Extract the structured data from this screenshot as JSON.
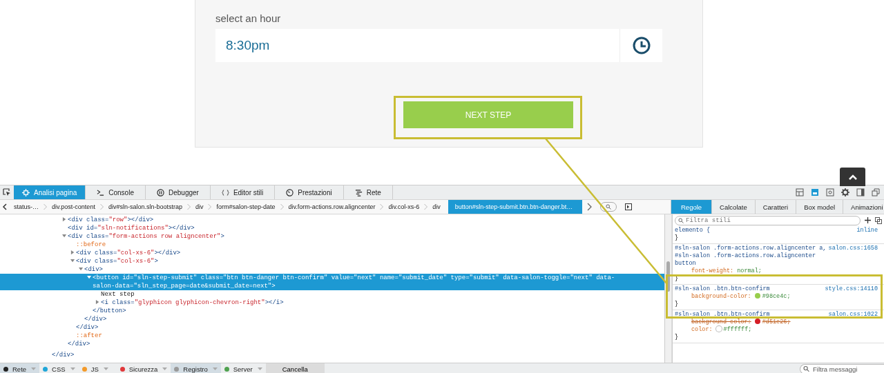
{
  "page": {
    "hour_label": "select an hour",
    "hour_value": "8:30pm",
    "next_button": "NEXT STEP"
  },
  "toolbar": {
    "tabs": [
      {
        "label": "Analisi pagina",
        "selected": true
      },
      {
        "label": "Console",
        "selected": false
      },
      {
        "label": "Debugger",
        "selected": false
      },
      {
        "label": "Editor stili",
        "selected": false
      },
      {
        "label": "Prestazioni",
        "selected": false
      },
      {
        "label": "Rete",
        "selected": false
      }
    ]
  },
  "breadcrumbs": [
    {
      "label": "status-…",
      "selected": false
    },
    {
      "label": "div.post-content",
      "selected": false
    },
    {
      "label": "div#sln-salon.sln-bootstrap",
      "selected": false
    },
    {
      "label": "div",
      "selected": false
    },
    {
      "label": "form#salon-step-date",
      "selected": false
    },
    {
      "label": "div.form-actions.row.aligncenter",
      "selected": false
    },
    {
      "label": "div.col-xs-6",
      "selected": false
    },
    {
      "label": "div",
      "selected": false
    },
    {
      "label": "button#sln-step-submit.btn.btn-danger.bt…",
      "selected": true
    }
  ],
  "markup": {
    "nodes": [
      {
        "kind": "element",
        "open": "<div",
        "attrs": [
          {
            "name": " class=",
            "value": "\"row\""
          }
        ],
        "end": ">",
        "inline_close": "</div>",
        "expanded": false,
        "selected": false
      },
      {
        "kind": "element",
        "open": "<div",
        "attrs": [
          {
            "name": " id=",
            "value": "\"sln-notifications\""
          }
        ],
        "end": ">",
        "inline_close": "</div>",
        "selected": false
      },
      {
        "kind": "element",
        "open": "<div",
        "attrs": [
          {
            "name": " class=",
            "value": "\"form-actions row aligncenter\""
          }
        ],
        "end": ">",
        "expanded": true,
        "selected": false,
        "close": "</div>",
        "children": [
          {
            "kind": "pseudo",
            "text": "::before"
          },
          {
            "kind": "element",
            "open": "<div",
            "attrs": [
              {
                "name": " class=",
                "value": "\"col-xs-6\""
              }
            ],
            "end": ">",
            "inline_close": "</div>",
            "expanded": false,
            "selected": false
          },
          {
            "kind": "element",
            "open": "<div",
            "attrs": [
              {
                "name": " class=",
                "value": "\"col-xs-6\""
              }
            ],
            "end": ">",
            "expanded": true,
            "selected": false,
            "close": "</div>",
            "children": [
              {
                "kind": "element",
                "open": "<div",
                "end": ">",
                "expanded": true,
                "selected": false,
                "close": "</div>",
                "children": [
                  {
                    "kind": "element",
                    "open": "<button",
                    "attrs": [
                      {
                        "name": " id=",
                        "value": "\"sln-step-submit\""
                      },
                      {
                        "name": " class=",
                        "value": "\"btn btn-danger btn-confirm\""
                      },
                      {
                        "name": " value=",
                        "value": "\"next\""
                      },
                      {
                        "name": " name=",
                        "value": "\"submit_date\""
                      },
                      {
                        "name": " type=",
                        "value": "\"submit\""
                      },
                      {
                        "name": " data-salon-toggle=",
                        "value": "\"next\""
                      },
                      {
                        "name": " data-salon-data=",
                        "value": "\"sln_step_page=date&submit_date=next\""
                      }
                    ],
                    "end": ">",
                    "expanded": true,
                    "selected": true,
                    "close": "</button>",
                    "children": [
                      {
                        "kind": "text",
                        "text": "Next step"
                      },
                      {
                        "kind": "element",
                        "open": "<i",
                        "attrs": [
                          {
                            "name": " class=",
                            "value": "\"glyphicon glyphicon-chevron-right\""
                          }
                        ],
                        "end": ">",
                        "inline_close": "</i>",
                        "expanded": false,
                        "selected": false
                      }
                    ]
                  }
                ]
              }
            ]
          },
          {
            "kind": "pseudo",
            "text": "::after"
          }
        ]
      }
    ],
    "closing": "</div>"
  },
  "rules": {
    "tabs": [
      {
        "label": "Regole",
        "selected": true
      },
      {
        "label": "Calcolate",
        "selected": false
      },
      {
        "label": "Caratteri",
        "selected": false
      },
      {
        "label": "Box model",
        "selected": false
      },
      {
        "label": "Animazioni",
        "selected": false
      }
    ],
    "filter_placeholder": "Filtra stili",
    "blocks": [
      {
        "selectors": [
          "elemento {"
        ],
        "source": "inline",
        "close": "}"
      },
      {
        "selectors": [
          "#sln-salon .form-actions.row.aligncenter a,",
          "#sln-salon .form-actions.row.aligncenter",
          "button"
        ],
        "source": "salon.css:1658",
        "declarations": [
          {
            "property": "font-weight:",
            "value": "normal;",
            "overridden": false
          }
        ],
        "close": "}"
      },
      {
        "selectors": [
          "#sln-salon .btn.btn-confirm"
        ],
        "source": "style.css:14110",
        "declarations": [
          {
            "property": "background-color:",
            "value": "#98ce4c;",
            "color": "#98ce4c",
            "overridden": false
          }
        ],
        "close": "}"
      },
      {
        "selectors": [
          "#sln-salon .btn.btn-confirm"
        ],
        "source": "salon.css:1022",
        "declarations": [
          {
            "property": "background-color:",
            "value": "#d51e26;",
            "color": "#d51e26",
            "overridden": true
          },
          {
            "property": "color:",
            "value": "#ffffff;",
            "color": "#ffffff",
            "overridden": false
          }
        ],
        "close": "}"
      }
    ]
  },
  "console_bar": {
    "filters": [
      {
        "label": "Rete",
        "color": "#222222",
        "selected": true
      },
      {
        "label": "CSS",
        "color": "#1fa6d8",
        "selected": false
      },
      {
        "label": "JS",
        "color": "#f39a2a",
        "selected": false
      },
      {
        "label": "Sicurezza",
        "color": "#e0383b",
        "selected": false
      },
      {
        "label": "Registro",
        "color": "#9a9a9a",
        "selected": true
      },
      {
        "label": "Server",
        "color": "#4fa24f",
        "selected": false
      }
    ],
    "clear_button": "Cancella",
    "filter_placeholder": "Filtra messaggi"
  }
}
